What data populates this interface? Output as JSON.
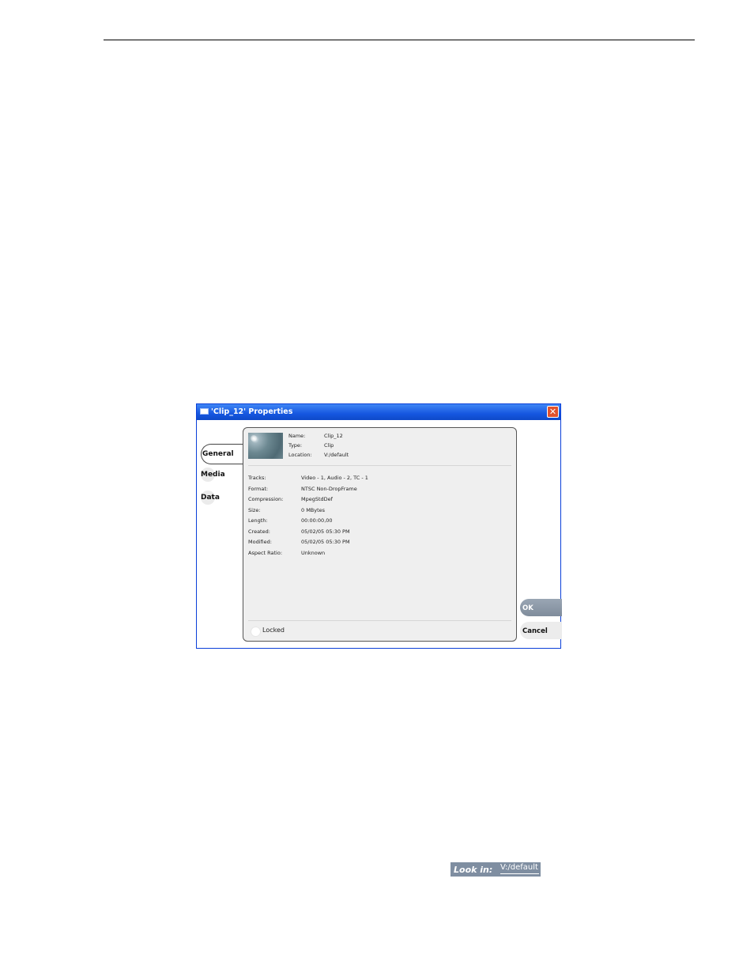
{
  "dialog": {
    "title": "'Clip_12' Properties",
    "close_icon": "close-x-icon",
    "tabs": [
      {
        "label": "General",
        "selected": true
      },
      {
        "label": "Media",
        "selected": false
      },
      {
        "label": "Data",
        "selected": false
      }
    ],
    "header_fields": [
      {
        "label": "Name:",
        "value": "Clip_12"
      },
      {
        "label": "Type:",
        "value": "Clip"
      },
      {
        "label": "Location:",
        "value": "V:/default"
      }
    ],
    "properties": [
      {
        "label": "Tracks:",
        "value": "Video - 1, Audio - 2, TC - 1"
      },
      {
        "label": "Format:",
        "value": "NTSC Non-DropFrame"
      },
      {
        "label": "Compression:",
        "value": "MpegStdDef"
      },
      {
        "label": "Size:",
        "value": "0 MBytes"
      },
      {
        "label": "Length:",
        "value": "00:00:00,00"
      },
      {
        "label": "Created:",
        "value": "05/02/05 05:30 PM"
      },
      {
        "label": "Modified:",
        "value": "05/02/05 05:30 PM"
      },
      {
        "label": "Aspect Ratio:",
        "value": "Unknown"
      }
    ],
    "locked_label": "Locked",
    "locked_checked": false,
    "ok_label": "OK",
    "cancel_label": "Cancel"
  },
  "look_in": {
    "label": "Look in:",
    "value": "V:/default"
  },
  "colors": {
    "titlebar": "#1657e0",
    "dialog_border": "#0a3fd8",
    "close_button": "#e2522d",
    "ok_button": "#8a97a6",
    "look_in_bg": "#7f8ea1"
  }
}
